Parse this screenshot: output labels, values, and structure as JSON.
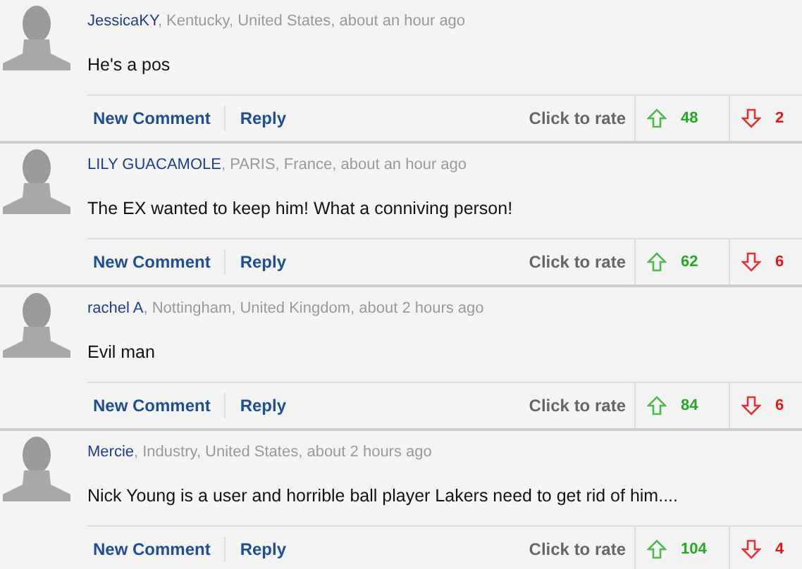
{
  "comments": [
    {
      "author": "JessicaKY",
      "meta": ", Kentucky, United States, about an hour ago",
      "text": "He's a pos",
      "actions": [
        "New Comment",
        "Reply"
      ],
      "rate_label": "Click to rate",
      "up_votes": "48",
      "down_votes": "2"
    },
    {
      "author": "LILY GUACAMOLE",
      "meta": ", PARIS, France, about an hour ago",
      "text": "The EX wanted to keep him! What a conniving person!",
      "actions": [
        "New Comment",
        "Reply"
      ],
      "rate_label": "Click to rate",
      "up_votes": "62",
      "down_votes": "6"
    },
    {
      "author": "rachel A",
      "meta": ", Nottingham, United Kingdom, about 2 hours ago",
      "text": "Evil man",
      "actions": [
        "New Comment",
        "Reply"
      ],
      "rate_label": "Click to rate",
      "up_votes": "84",
      "down_votes": "6"
    },
    {
      "author": "Mercie",
      "meta": ", Industry, United States, about 2 hours ago",
      "text": "Nick Young is a user and horrible ball player Lakers need to get rid of him....",
      "actions": [
        "New Comment",
        "Reply"
      ],
      "rate_label": "Click to rate",
      "up_votes": "104",
      "down_votes": "4"
    }
  ]
}
